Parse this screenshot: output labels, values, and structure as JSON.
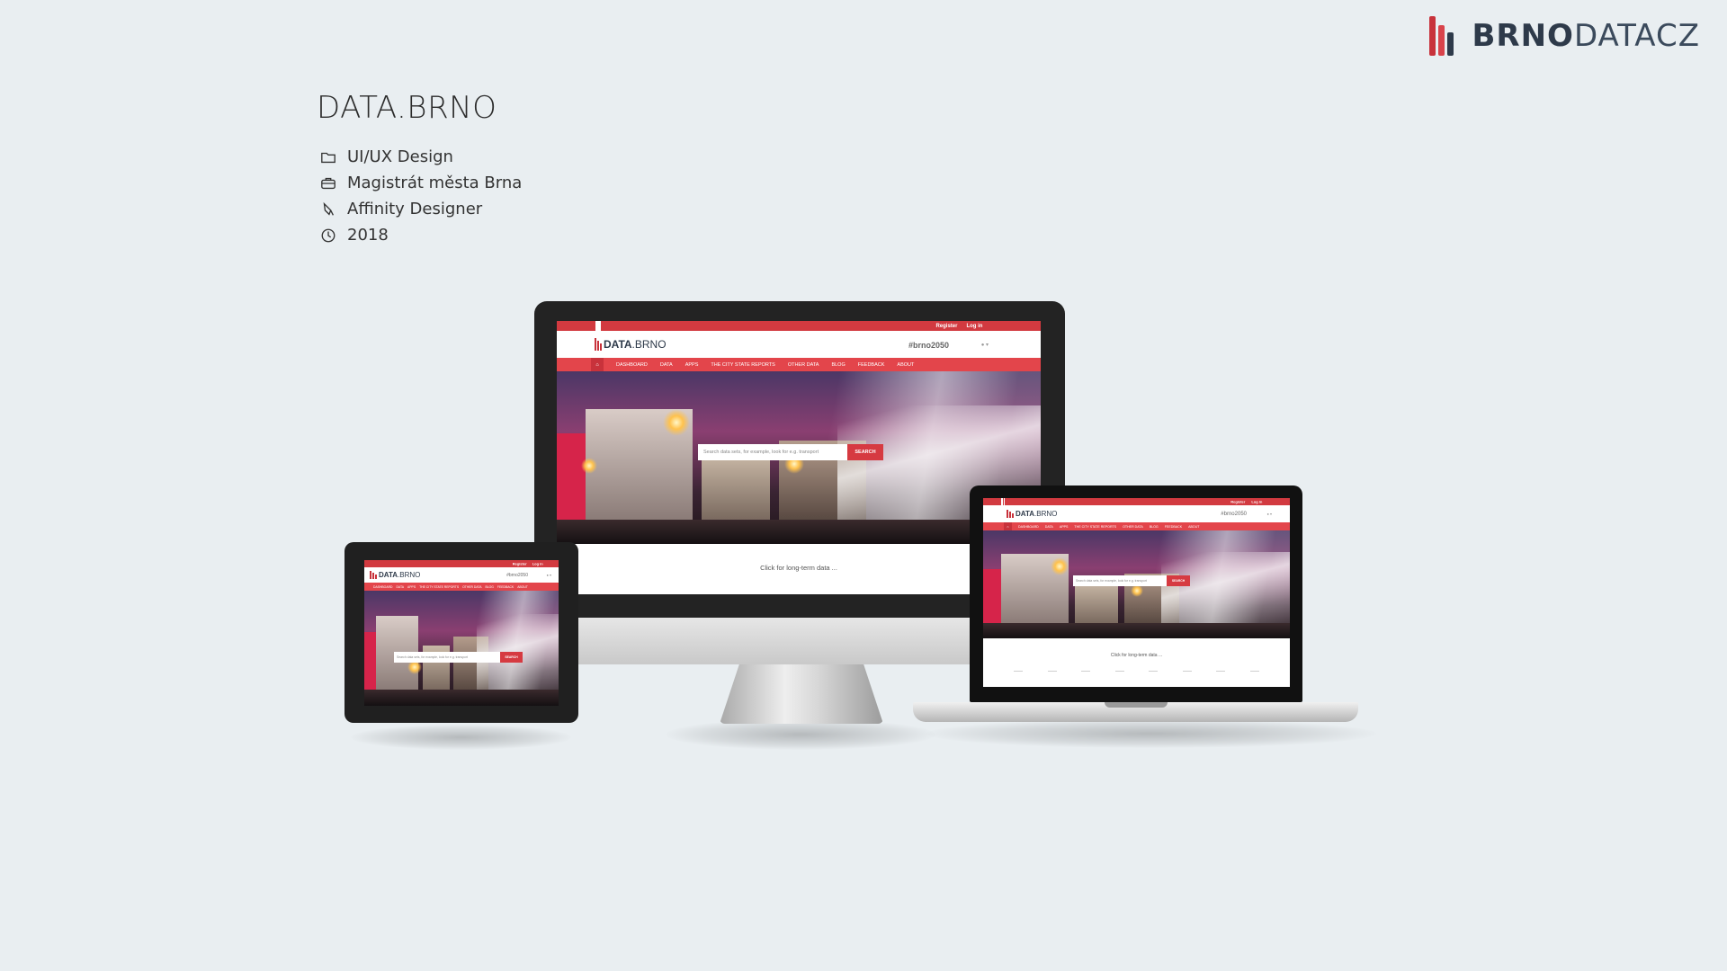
{
  "brand": {
    "bold": "BRNO",
    "light": "DATACZ"
  },
  "project": {
    "title": "DATA.BRNO",
    "meta": [
      {
        "icon": "folder-icon",
        "label": "UI/UX Design"
      },
      {
        "icon": "briefcase-icon",
        "label": "Magistrát města Brna"
      },
      {
        "icon": "pen-icon",
        "label": "Affinity Designer"
      },
      {
        "icon": "clock-icon",
        "label": "2018"
      }
    ]
  },
  "site": {
    "register": "Register",
    "login": "Log in",
    "logo_bold": "DATA",
    "logo_light": ".BRNO",
    "hashtag": "#brno2050",
    "nav": [
      "DASHBOARD",
      "DATA",
      "APPS",
      "THE CITY STATE REPORTS",
      "OTHER DATA",
      "BLOG",
      "FEEDBACK",
      "ABOUT"
    ],
    "search_placeholder": "Search data sets, for example, look for e.g. transport",
    "search_button": "SEARCH",
    "caption": "Click for long-term data ..."
  },
  "colors": {
    "accent": "#d23a40",
    "brand_dark": "#2e3a4a",
    "background": "#e9eef1"
  }
}
